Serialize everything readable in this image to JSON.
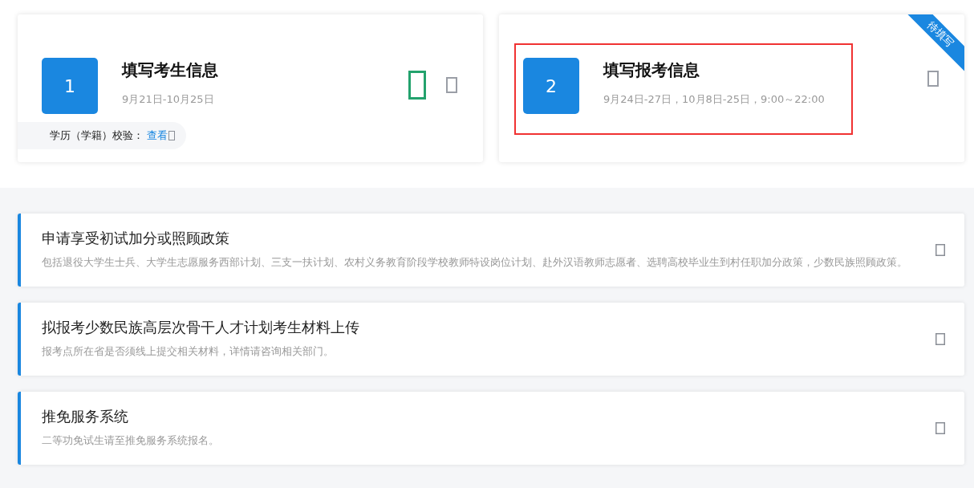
{
  "steps": [
    {
      "number": "1",
      "title": "填写考生信息",
      "date": "9月21日-10月25日",
      "highlighted": false,
      "note": {
        "label": "学历（学籍）校验：",
        "link": "查看"
      },
      "icons": [
        {
          "kind": "large",
          "color": "#23a26d"
        },
        {
          "kind": "small",
          "color": "#9a9ea6"
        }
      ]
    },
    {
      "number": "2",
      "title": "填写报考信息",
      "date": "9月24日-27日，10月8日-25日，9:00～22:00",
      "highlighted": true,
      "ribbon": "待填写",
      "icons": [
        {
          "kind": "small",
          "color": "#9a9ea6"
        }
      ]
    }
  ],
  "policies": [
    {
      "title": "申请享受初试加分或照顾政策",
      "description": "包括退役大学生士兵、大学生志愿服务西部计划、三支一扶计划、农村义务教育阶段学校教师特设岗位计划、赴外汉语教师志愿者、选聘高校毕业生到村任职加分政策，少数民族照顾政策。"
    },
    {
      "title": "拟报考少数民族高层次骨干人才计划考生材料上传",
      "description": "报考点所在省是否须线上提交相关材料，详情请咨询相关部门。"
    },
    {
      "title": "推免服务系统",
      "description": "二等功免试生请至推免服务系统报名。"
    }
  ]
}
